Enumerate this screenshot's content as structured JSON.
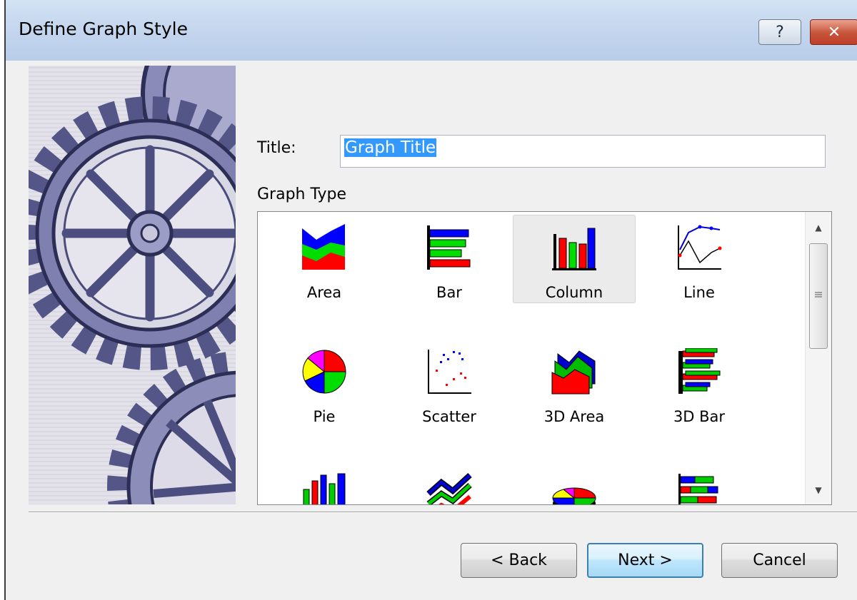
{
  "window": {
    "title": "Define Graph Style",
    "help_glyph": "?",
    "close_glyph": "✕"
  },
  "form": {
    "title_label": "Title:",
    "title_value": "Graph Title",
    "graph_type_label": "Graph Type"
  },
  "graph_types": [
    {
      "label": "Area",
      "icon": "area-chart-icon",
      "selected": false
    },
    {
      "label": "Bar",
      "icon": "bar-chart-icon",
      "selected": false
    },
    {
      "label": "Column",
      "icon": "column-chart-icon",
      "selected": true
    },
    {
      "label": "Line",
      "icon": "line-chart-icon",
      "selected": false
    },
    {
      "label": "Pie",
      "icon": "pie-chart-icon",
      "selected": false
    },
    {
      "label": "Scatter",
      "icon": "scatter-chart-icon",
      "selected": false
    },
    {
      "label": "3D Area",
      "icon": "3d-area-chart-icon",
      "selected": false
    },
    {
      "label": "3D Bar",
      "icon": "3d-bar-chart-icon",
      "selected": false
    },
    {
      "label": "",
      "icon": "3d-column-chart-icon",
      "selected": false
    },
    {
      "label": "",
      "icon": "3d-line-chart-icon",
      "selected": false
    },
    {
      "label": "",
      "icon": "3d-pie-chart-icon",
      "selected": false
    },
    {
      "label": "",
      "icon": "stacked-bar-chart-icon",
      "selected": false
    }
  ],
  "buttons": {
    "back": "< Back",
    "next": "Next >",
    "cancel": "Cancel"
  },
  "colors": {
    "selection": "#3399ff",
    "titlebar": "#c4d6ee",
    "gear": "#6e6fa3"
  }
}
